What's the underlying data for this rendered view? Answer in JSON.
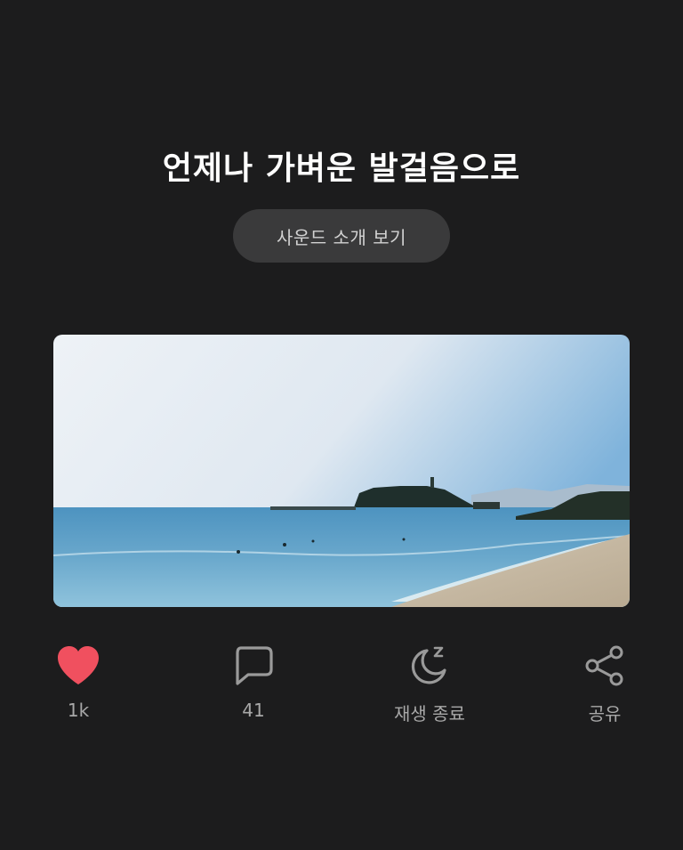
{
  "title": "언제나 가벼운 발걸음으로",
  "sound_button": {
    "label": "사운드 소개 보기"
  },
  "image": {
    "subject": "beach-with-island"
  },
  "actions": [
    {
      "icon": "heart-icon",
      "label": "1k",
      "color": "#f0505f"
    },
    {
      "icon": "comment-icon",
      "label": "41"
    },
    {
      "icon": "moon-sleep-icon",
      "label": "재생 종료"
    },
    {
      "icon": "share-icon",
      "label": "공유"
    }
  ],
  "colors": {
    "background": "#1c1c1d",
    "button_bg": "#3a3a3b",
    "icon_gray": "#9a9a9a",
    "label_gray": "#a8a8a8"
  }
}
